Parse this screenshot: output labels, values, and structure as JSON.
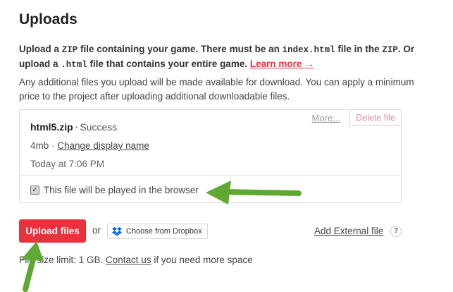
{
  "title": "Uploads",
  "intro": {
    "p1": "Upload a ",
    "zip": "ZIP",
    "p2": " file containing your game. There must be an ",
    "index": "index.html",
    "p3": " file in the ",
    "zip2": "ZIP",
    "p4": ". Or upload a ",
    "html": ".html",
    "p5": " file that contains your entire game. ",
    "learn_more": "Learn more →"
  },
  "note": "Any additional files you upload will be made available for download. You can apply a minimum price to the project after uploading additional downloadable files.",
  "file": {
    "name": "html5.zip",
    "separator": "·",
    "status": "Success",
    "size": "4mb",
    "meta_sep": " · ",
    "change_display": "Change display name",
    "date": "Today at 7:06 PM",
    "browser_label": "This file will be played in the browser",
    "browser_checked": true,
    "more": "More...",
    "delete": "Delete file"
  },
  "actions": {
    "upload": "Upload files",
    "or": "or",
    "dropbox": "Choose from Dropbox",
    "add_external": "Add External file",
    "help": "?"
  },
  "size_note": {
    "text1": "File size limit: 1 GB. ",
    "contact": "Contact us",
    "text2": " if you need more space"
  },
  "colors": {
    "accent": "#e8333d",
    "arrow": "#5fa831",
    "dropbox": "#0061fe"
  }
}
